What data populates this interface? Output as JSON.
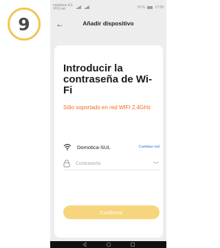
{
  "step": {
    "number": "9"
  },
  "status_bar": {
    "carrier": "vodafone ES",
    "carrier_line2": "VFS.net",
    "battery": "76 %",
    "time": "17:59"
  },
  "header": {
    "title": "Añadir dispositivo",
    "back_icon": "arrow-left-icon"
  },
  "content": {
    "heading": "Introducir la contraseña de Wi-Fi",
    "note": "Sólo soportado en red WIFI 2,4GHz"
  },
  "wifi": {
    "network_name": "Domotica-SUL",
    "change_label": "Cambiar red",
    "icon": "wifi-icon"
  },
  "password": {
    "placeholder": "Contraseña",
    "value": "",
    "icon": "lock-icon",
    "toggle_icon": "eye-closed-icon"
  },
  "confirm": {
    "label": "Confirmar"
  },
  "colors": {
    "accent": "#f0c64d",
    "button": "#f6d57c",
    "warning": "#f26b1d",
    "link": "#3a6fd8"
  }
}
